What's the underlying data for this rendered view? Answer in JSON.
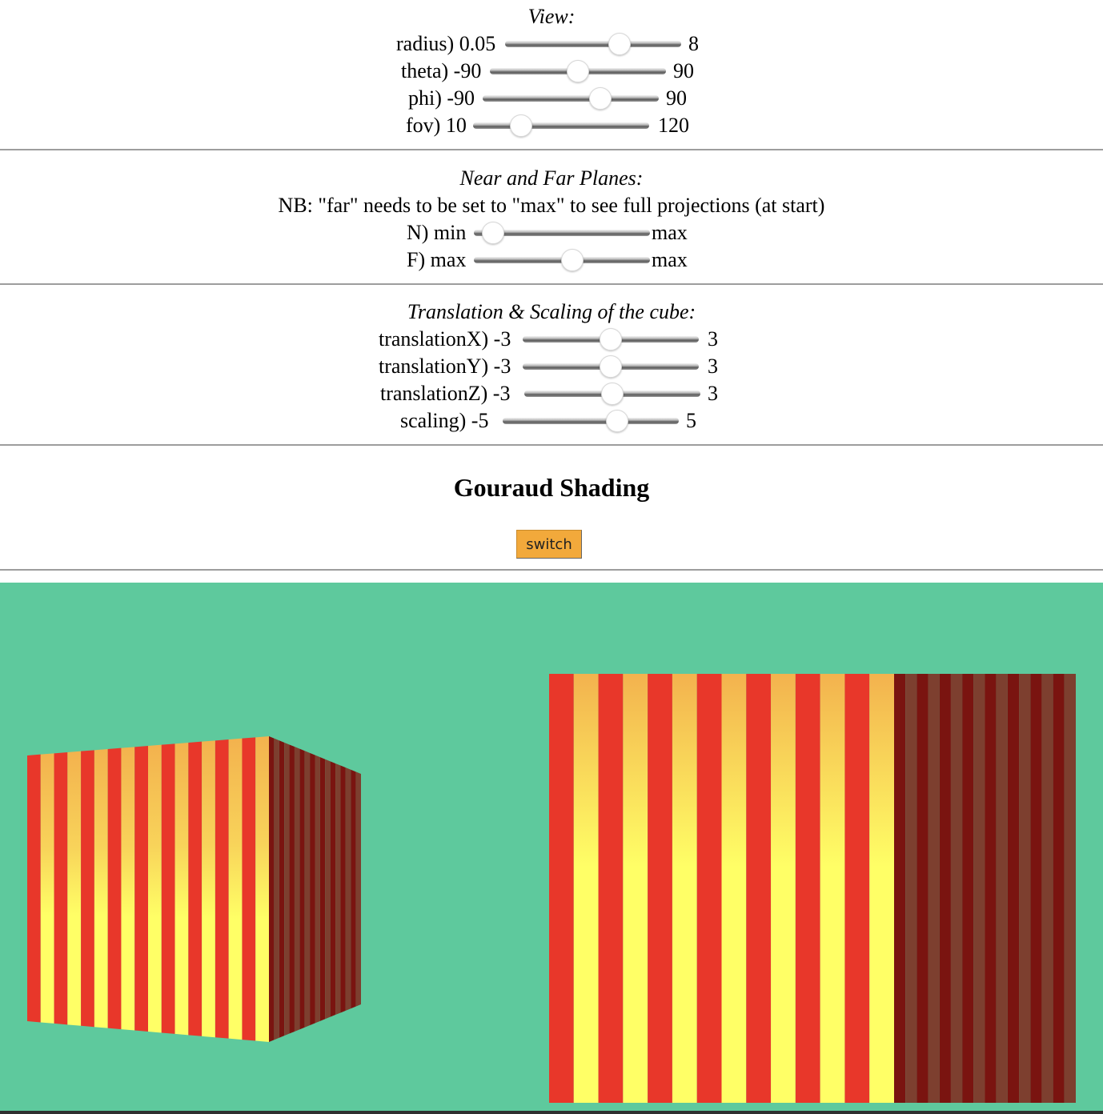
{
  "view": {
    "heading": "View:",
    "sliders": [
      {
        "name": "radius",
        "label": "radius) 0.05",
        "max_label": "8",
        "min": 0.05,
        "max": 8,
        "value": 5.2
      },
      {
        "name": "theta",
        "label": "theta) -90",
        "max_label": "90",
        "min": -90,
        "max": 90,
        "value": 0
      },
      {
        "name": "phi",
        "label": "phi) -90",
        "max_label": "90",
        "min": -90,
        "max": 90,
        "value": 30
      },
      {
        "name": "fov",
        "label": "fov) 10",
        "max_label": "120",
        "min": 10,
        "max": 120,
        "value": 40
      }
    ]
  },
  "planes": {
    "heading": "Near and Far Planes:",
    "note": "NB: \"far\" needs to be set to \"max\" to see full projections (at start)",
    "sliders": [
      {
        "name": "near",
        "label": "N) min",
        "max_label": "max",
        "fraction": 0.11
      },
      {
        "name": "far",
        "label": "F) max",
        "max_label": "max",
        "fraction": 0.56
      }
    ]
  },
  "transform": {
    "heading": "Translation & Scaling of the cube:",
    "sliders": [
      {
        "name": "translationX",
        "label": "translationX) -3",
        "max_label": "3",
        "min": -3,
        "max": 3,
        "value": 0
      },
      {
        "name": "translationY",
        "label": "translationY) -3",
        "max_label": "3",
        "min": -3,
        "max": 3,
        "value": 0
      },
      {
        "name": "translationZ",
        "label": "translationZ) -3",
        "max_label": "3",
        "min": -3,
        "max": 3,
        "value": 0
      },
      {
        "name": "scaling",
        "label": "scaling) -5",
        "max_label": "5",
        "min": -5,
        "max": 5,
        "value": 1.5
      }
    ]
  },
  "shading": {
    "title": "Gouraud Shading",
    "switch_label": "switch"
  },
  "colors": {
    "scene_background": "#5ec99d",
    "stripe_red": "#e8372a",
    "stripe_yellow": "#ffff66",
    "stripe_orange": "#f3b24e",
    "side_dark": "#7a1410",
    "side_brown": "#7d3f2f",
    "button": "#f2a93b"
  }
}
